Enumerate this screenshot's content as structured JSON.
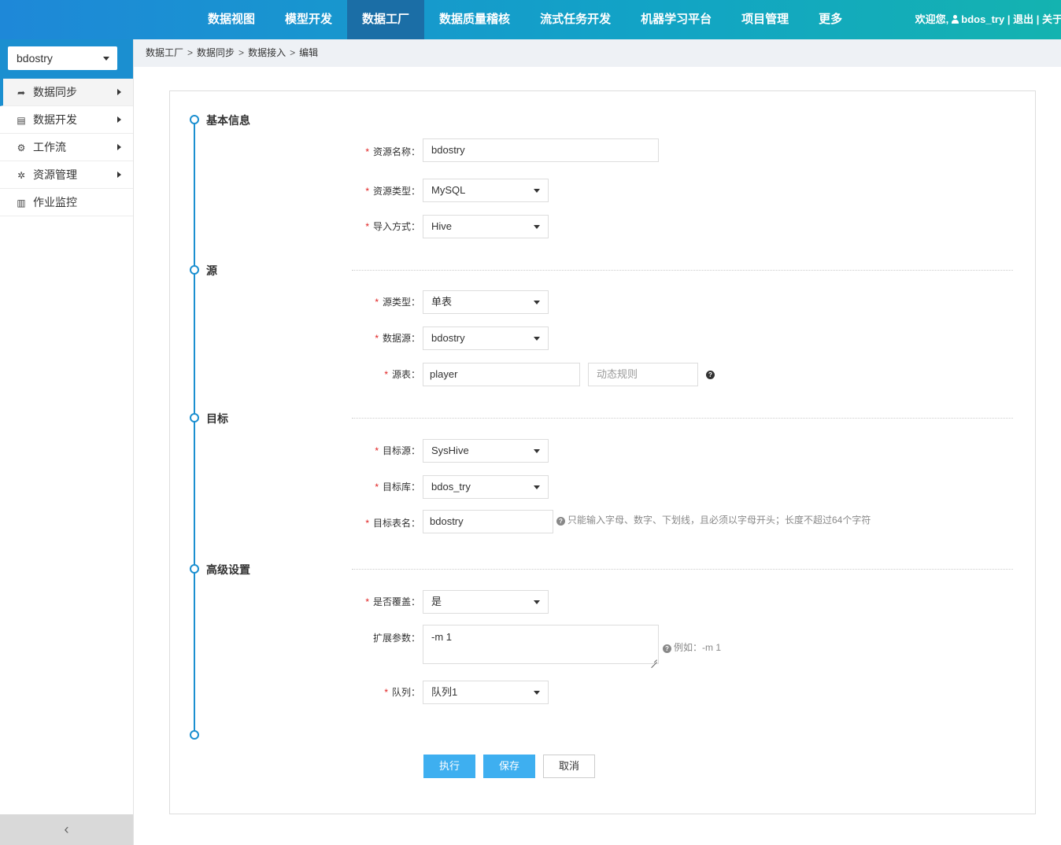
{
  "topnav": {
    "items": [
      "数据视图",
      "模型开发",
      "数据工厂",
      "数据质量稽核",
      "流式任务开发",
      "机器学习平台",
      "项目管理",
      "更多"
    ],
    "active_index": 2
  },
  "user": {
    "welcome": "欢迎您,",
    "name": "bdos_try",
    "logout": "退出",
    "about": "关于",
    "separator": "|"
  },
  "sidebar": {
    "project": "bdostry",
    "items": [
      {
        "label": "数据同步",
        "icon": "share-arrow-icon"
      },
      {
        "label": "数据开发",
        "icon": "code-file-icon"
      },
      {
        "label": "工作流",
        "icon": "gears-icon"
      },
      {
        "label": "资源管理",
        "icon": "gear-icon"
      },
      {
        "label": "作业监控",
        "icon": "monitor-icon"
      }
    ],
    "collapse": "‹"
  },
  "breadcrumb": [
    "数据工厂",
    "数据同步",
    "数据接入",
    "编辑"
  ],
  "breadcrumb_sep": ">",
  "sections": {
    "basic": "基本信息",
    "source": "源",
    "target": "目标",
    "advanced": "高级设置"
  },
  "form": {
    "resource_name": {
      "label": "资源名称：",
      "value": "bdostry"
    },
    "resource_type": {
      "label": "资源类型：",
      "value": "MySQL"
    },
    "import_mode": {
      "label": "导入方式：",
      "value": "Hive"
    },
    "source_type": {
      "label": "源类型：",
      "value": "单表"
    },
    "datasource": {
      "label": "数据源：",
      "value": "bdostry"
    },
    "source_table": {
      "label": "源表：",
      "value": "player",
      "rule_placeholder": "动态规则"
    },
    "target_source": {
      "label": "目标源：",
      "value": "SysHive"
    },
    "target_db": {
      "label": "目标库：",
      "value": "bdos_try"
    },
    "target_table": {
      "label": "目标表名：",
      "value": "bdostry",
      "hint": "只能输入字母、数字、下划线，且必须以字母开头；长度不超过64个字符"
    },
    "overwrite": {
      "label": "是否覆盖：",
      "value": "是"
    },
    "ext_params": {
      "label": "扩展参数：",
      "value": "-m 1",
      "hint": "例如：-m 1"
    },
    "queue": {
      "label": "队列：",
      "value": "队列1"
    },
    "required_mark": "*"
  },
  "buttons": {
    "execute": "执行",
    "save": "保存",
    "cancel": "取消"
  },
  "colors": {
    "accent": "#1b8fd0",
    "button_primary": "#3eaff0",
    "required": "#e02020"
  }
}
